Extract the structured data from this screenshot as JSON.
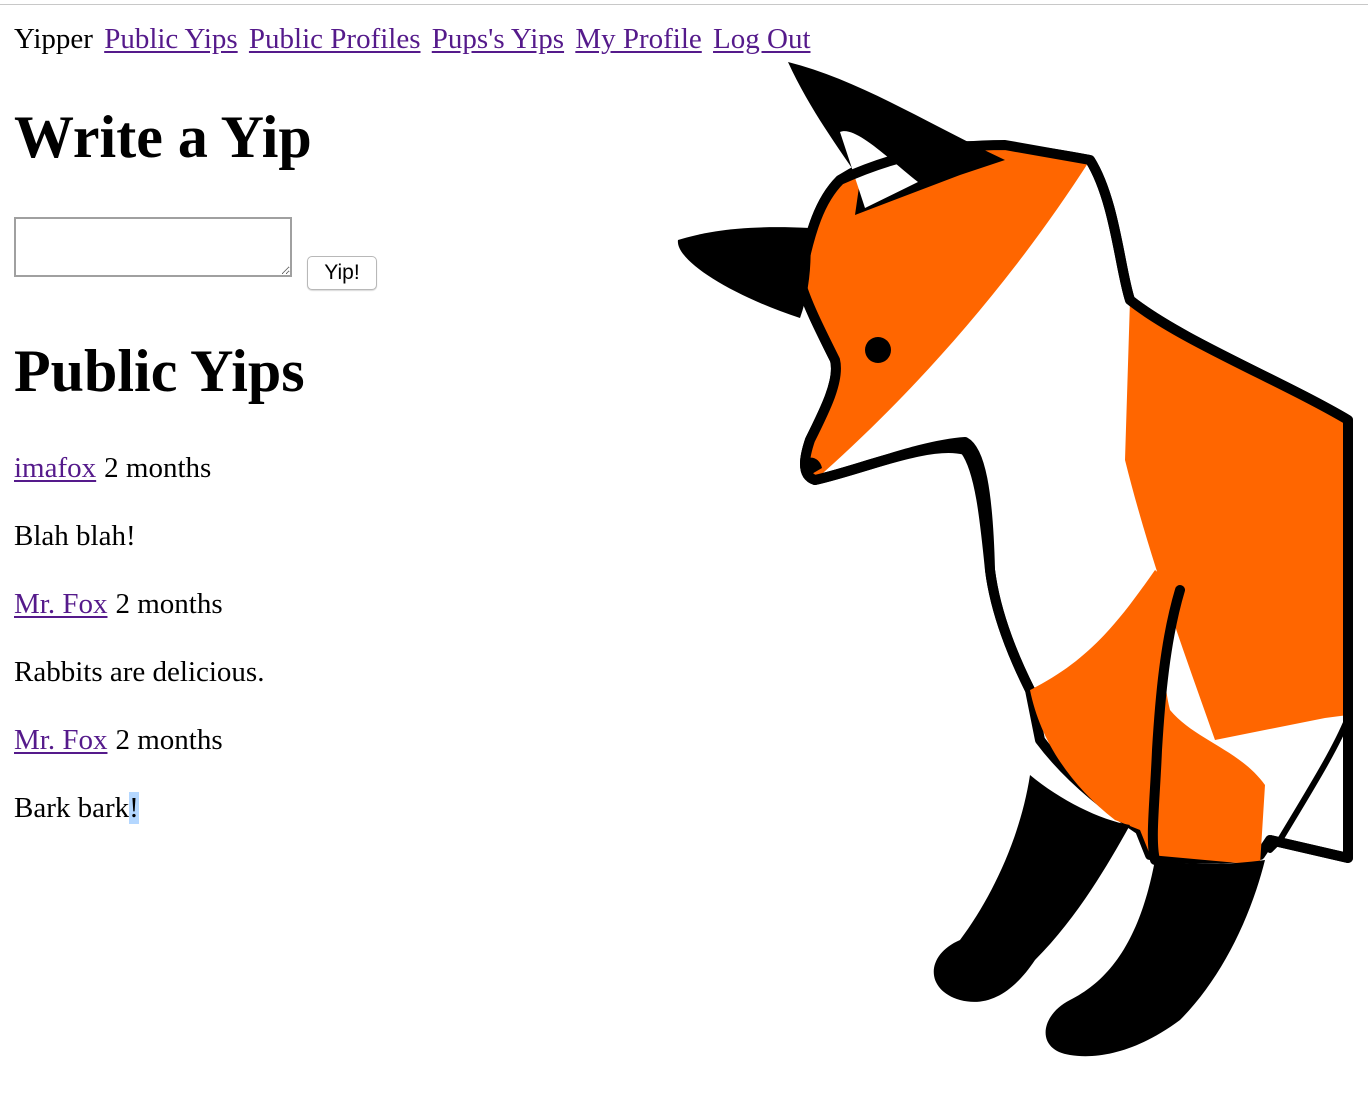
{
  "nav": {
    "brand": "Yipper",
    "links": [
      "Public Yips",
      "Public Profiles",
      "Pups's Yips",
      "My Profile",
      "Log Out"
    ]
  },
  "compose": {
    "heading": "Write a Yip",
    "textarea_value": "",
    "button_label": "Yip!"
  },
  "feed": {
    "heading": "Public Yips",
    "yips": [
      {
        "author": "imafox",
        "time": "2 months",
        "text": "Blah blah!"
      },
      {
        "author": "Mr. Fox",
        "time": "2 months",
        "text": "Rabbits are delicious."
      },
      {
        "author": "Mr. Fox",
        "time": "2 months",
        "text_main": "Bark bark",
        "text_selected": "!"
      }
    ]
  },
  "colors": {
    "link": "#551a8b",
    "fox_orange": "#ff6600",
    "selection": "#b4d7ff"
  },
  "illustration": {
    "icon": "fox-illustration"
  }
}
